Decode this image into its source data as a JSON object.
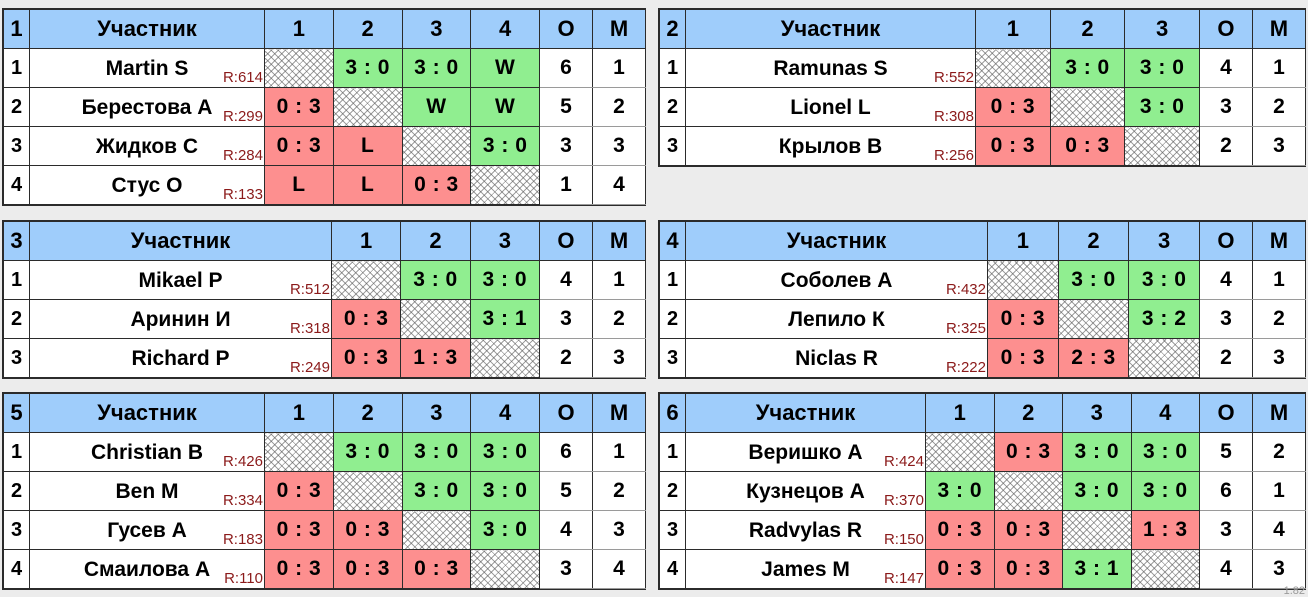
{
  "page": {
    "watermark": "1.82",
    "background_color": "#ececec",
    "colors": {
      "header_blue": "#9fcdfb",
      "group_index_purple": "#6d6d9e",
      "win_green": "#90ee90",
      "loss_red": "#fd8f8f",
      "rating_text": "#8b1a1a",
      "border": "#2b2b2b"
    }
  },
  "columns": {
    "participant_header": "Участник",
    "points_header": "О",
    "place_header": "М"
  },
  "groups": [
    {
      "number": "1",
      "participant_label": "Участник",
      "opponent_headers": [
        "1",
        "2",
        "3",
        "4"
      ],
      "points_label": "О",
      "place_label": "М",
      "rows": [
        {
          "rank": "1",
          "name": "Martin S",
          "rating": "R:614",
          "results": [
            {
              "text": "",
              "state": "diag"
            },
            {
              "text": "3 : 0",
              "state": "win"
            },
            {
              "text": "3 : 0",
              "state": "win"
            },
            {
              "text": "W",
              "state": "win"
            }
          ],
          "points": "6",
          "place": "1"
        },
        {
          "rank": "2",
          "name": "Берестова А",
          "rating": "R:299",
          "results": [
            {
              "text": "0 : 3",
              "state": "loss"
            },
            {
              "text": "",
              "state": "diag"
            },
            {
              "text": "W",
              "state": "win"
            },
            {
              "text": "W",
              "state": "win"
            }
          ],
          "points": "5",
          "place": "2"
        },
        {
          "rank": "3",
          "name": "Жидков С",
          "rating": "R:284",
          "results": [
            {
              "text": "0 : 3",
              "state": "loss"
            },
            {
              "text": "L",
              "state": "loss"
            },
            {
              "text": "",
              "state": "diag"
            },
            {
              "text": "3 : 0",
              "state": "win"
            }
          ],
          "points": "3",
          "place": "3"
        },
        {
          "rank": "4",
          "name": "Стус О",
          "rating": "R:133",
          "results": [
            {
              "text": "L",
              "state": "loss"
            },
            {
              "text": "L",
              "state": "loss"
            },
            {
              "text": "0 : 3",
              "state": "loss"
            },
            {
              "text": "",
              "state": "diag"
            }
          ],
          "points": "1",
          "place": "4"
        }
      ]
    },
    {
      "number": "2",
      "participant_label": "Участник",
      "opponent_headers": [
        "1",
        "2",
        "3"
      ],
      "points_label": "О",
      "place_label": "М",
      "rows": [
        {
          "rank": "1",
          "name": "Ramunas S",
          "rating": "R:552",
          "results": [
            {
              "text": "",
              "state": "diag"
            },
            {
              "text": "3 : 0",
              "state": "win"
            },
            {
              "text": "3 : 0",
              "state": "win"
            }
          ],
          "points": "4",
          "place": "1"
        },
        {
          "rank": "2",
          "name": "Lionel L",
          "rating": "R:308",
          "results": [
            {
              "text": "0 : 3",
              "state": "loss"
            },
            {
              "text": "",
              "state": "diag"
            },
            {
              "text": "3 : 0",
              "state": "win"
            }
          ],
          "points": "3",
          "place": "2"
        },
        {
          "rank": "3",
          "name": "Крылов В",
          "rating": "R:256",
          "results": [
            {
              "text": "0 : 3",
              "state": "loss"
            },
            {
              "text": "0 : 3",
              "state": "loss"
            },
            {
              "text": "",
              "state": "diag"
            }
          ],
          "points": "2",
          "place": "3"
        }
      ]
    },
    {
      "number": "3",
      "participant_label": "Участник",
      "opponent_headers": [
        "1",
        "2",
        "3"
      ],
      "points_label": "О",
      "place_label": "М",
      "rows": [
        {
          "rank": "1",
          "name": "Mikael P",
          "rating": "R:512",
          "results": [
            {
              "text": "",
              "state": "diag"
            },
            {
              "text": "3 : 0",
              "state": "win"
            },
            {
              "text": "3 : 0",
              "state": "win"
            }
          ],
          "points": "4",
          "place": "1"
        },
        {
          "rank": "2",
          "name": "Аринин И",
          "rating": "R:318",
          "results": [
            {
              "text": "0 : 3",
              "state": "loss"
            },
            {
              "text": "",
              "state": "diag"
            },
            {
              "text": "3 : 1",
              "state": "win"
            }
          ],
          "points": "3",
          "place": "2"
        },
        {
          "rank": "3",
          "name": "Richard P",
          "rating": "R:249",
          "results": [
            {
              "text": "0 : 3",
              "state": "loss"
            },
            {
              "text": "1 : 3",
              "state": "loss"
            },
            {
              "text": "",
              "state": "diag"
            }
          ],
          "points": "2",
          "place": "3"
        }
      ]
    },
    {
      "number": "4",
      "participant_label": "Участник",
      "opponent_headers": [
        "1",
        "2",
        "3"
      ],
      "points_label": "О",
      "place_label": "М",
      "rows": [
        {
          "rank": "1",
          "name": "Соболев А",
          "rating": "R:432",
          "results": [
            {
              "text": "",
              "state": "diag"
            },
            {
              "text": "3 : 0",
              "state": "win"
            },
            {
              "text": "3 : 0",
              "state": "win"
            }
          ],
          "points": "4",
          "place": "1"
        },
        {
          "rank": "2",
          "name": "Лепило К",
          "rating": "R:325",
          "results": [
            {
              "text": "0 : 3",
              "state": "loss"
            },
            {
              "text": "",
              "state": "diag"
            },
            {
              "text": "3 : 2",
              "state": "win"
            }
          ],
          "points": "3",
          "place": "2"
        },
        {
          "rank": "3",
          "name": "Niclas R",
          "rating": "R:222",
          "results": [
            {
              "text": "0 : 3",
              "state": "loss"
            },
            {
              "text": "2 : 3",
              "state": "loss"
            },
            {
              "text": "",
              "state": "diag"
            }
          ],
          "points": "2",
          "place": "3"
        }
      ]
    },
    {
      "number": "5",
      "participant_label": "Участник",
      "opponent_headers": [
        "1",
        "2",
        "3",
        "4"
      ],
      "points_label": "О",
      "place_label": "М",
      "rows": [
        {
          "rank": "1",
          "name": "Christian B",
          "rating": "R:426",
          "results": [
            {
              "text": "",
              "state": "diag"
            },
            {
              "text": "3 : 0",
              "state": "win"
            },
            {
              "text": "3 : 0",
              "state": "win"
            },
            {
              "text": "3 : 0",
              "state": "win"
            }
          ],
          "points": "6",
          "place": "1"
        },
        {
          "rank": "2",
          "name": "Ben M",
          "rating": "R:334",
          "results": [
            {
              "text": "0 : 3",
              "state": "loss"
            },
            {
              "text": "",
              "state": "diag"
            },
            {
              "text": "3 : 0",
              "state": "win"
            },
            {
              "text": "3 : 0",
              "state": "win"
            }
          ],
          "points": "5",
          "place": "2"
        },
        {
          "rank": "3",
          "name": "Гусев А",
          "rating": "R:183",
          "results": [
            {
              "text": "0 : 3",
              "state": "loss"
            },
            {
              "text": "0 : 3",
              "state": "loss"
            },
            {
              "text": "",
              "state": "diag"
            },
            {
              "text": "3 : 0",
              "state": "win"
            }
          ],
          "points": "4",
          "place": "3"
        },
        {
          "rank": "4",
          "name": "Смаилова А",
          "rating": "R:110",
          "results": [
            {
              "text": "0 : 3",
              "state": "loss"
            },
            {
              "text": "0 : 3",
              "state": "loss"
            },
            {
              "text": "0 : 3",
              "state": "loss"
            },
            {
              "text": "",
              "state": "diag"
            }
          ],
          "points": "3",
          "place": "4"
        }
      ]
    },
    {
      "number": "6",
      "participant_label": "Участник",
      "opponent_headers": [
        "1",
        "2",
        "3",
        "4"
      ],
      "points_label": "О",
      "place_label": "М",
      "rows": [
        {
          "rank": "1",
          "name": "Веришко А",
          "rating": "R:424",
          "results": [
            {
              "text": "",
              "state": "diag"
            },
            {
              "text": "0 : 3",
              "state": "loss"
            },
            {
              "text": "3 : 0",
              "state": "win"
            },
            {
              "text": "3 : 0",
              "state": "win"
            }
          ],
          "points": "5",
          "place": "2"
        },
        {
          "rank": "2",
          "name": "Кузнецов А",
          "rating": "R:370",
          "results": [
            {
              "text": "3 : 0",
              "state": "win"
            },
            {
              "text": "",
              "state": "diag"
            },
            {
              "text": "3 : 0",
              "state": "win"
            },
            {
              "text": "3 : 0",
              "state": "win"
            }
          ],
          "points": "6",
          "place": "1"
        },
        {
          "rank": "3",
          "name": "Radvylas R",
          "rating": "R:150",
          "results": [
            {
              "text": "0 : 3",
              "state": "loss"
            },
            {
              "text": "0 : 3",
              "state": "loss"
            },
            {
              "text": "",
              "state": "diag"
            },
            {
              "text": "1 : 3",
              "state": "loss"
            }
          ],
          "points": "3",
          "place": "4"
        },
        {
          "rank": "4",
          "name": "James M",
          "rating": "R:147",
          "results": [
            {
              "text": "0 : 3",
              "state": "loss"
            },
            {
              "text": "0 : 3",
              "state": "loss"
            },
            {
              "text": "3 : 1",
              "state": "win"
            },
            {
              "text": "",
              "state": "diag"
            }
          ],
          "points": "4",
          "place": "3"
        }
      ]
    }
  ]
}
